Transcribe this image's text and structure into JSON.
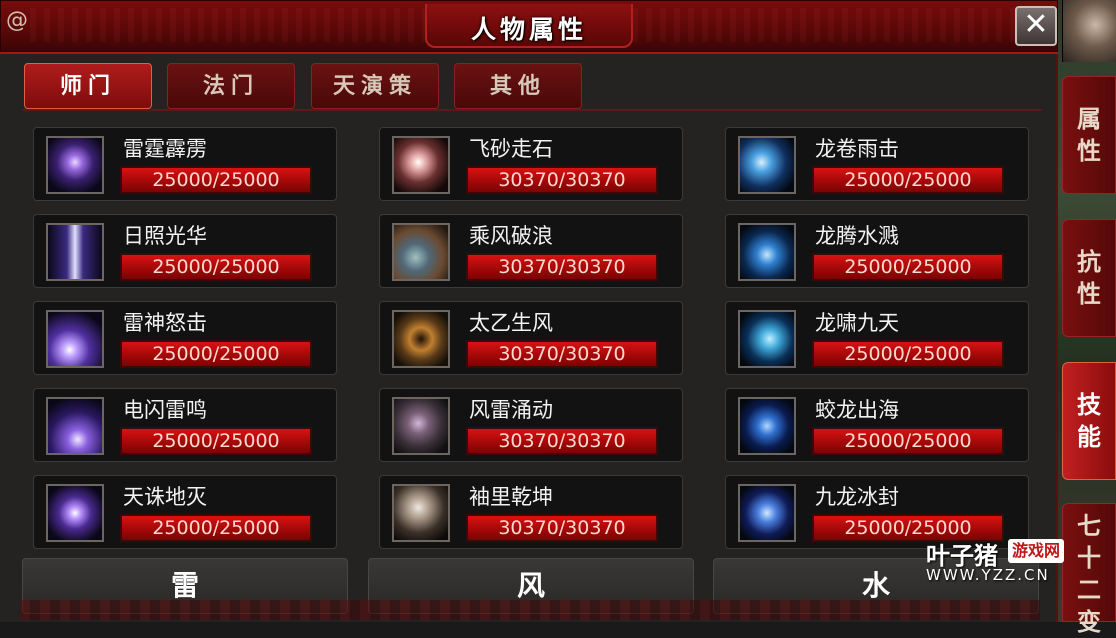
{
  "window": {
    "title": "人物属性",
    "close_label": "✕"
  },
  "tabs": [
    {
      "label": "师门",
      "active": true
    },
    {
      "label": "法门",
      "active": false
    },
    {
      "label": "天演策",
      "active": false
    },
    {
      "label": "其他",
      "active": false
    }
  ],
  "columns": [
    {
      "element": "雷",
      "skills": [
        {
          "name": "雷霆霹雳",
          "value": "25000/25000",
          "icon": "lightning-icon"
        },
        {
          "name": "日照光华",
          "value": "25000/25000",
          "icon": "light-beam-icon"
        },
        {
          "name": "雷神怒击",
          "value": "25000/25000",
          "icon": "thunder-strike-icon"
        },
        {
          "name": "电闪雷鸣",
          "value": "25000/25000",
          "icon": "lightning-flash-icon"
        },
        {
          "name": "天诛地灭",
          "value": "25000/25000",
          "icon": "lightning-burst-icon"
        }
      ]
    },
    {
      "element": "风",
      "skills": [
        {
          "name": "飞砂走石",
          "value": "30370/30370",
          "icon": "sand-storm-icon"
        },
        {
          "name": "乘风破浪",
          "value": "30370/30370",
          "icon": "wave-icon"
        },
        {
          "name": "太乙生风",
          "value": "30370/30370",
          "icon": "whirlwind-icon"
        },
        {
          "name": "风雷涌动",
          "value": "30370/30370",
          "icon": "storm-surge-icon"
        },
        {
          "name": "袖里乾坤",
          "value": "30370/30370",
          "icon": "sleeve-universe-icon"
        }
      ]
    },
    {
      "element": "水",
      "skills": [
        {
          "name": "龙卷雨击",
          "value": "25000/25000",
          "icon": "water-tornado-icon"
        },
        {
          "name": "龙腾水溅",
          "value": "25000/25000",
          "icon": "water-splash-icon"
        },
        {
          "name": "龙啸九天",
          "value": "25000/25000",
          "icon": "dragon-roar-icon"
        },
        {
          "name": "蛟龙出海",
          "value": "25000/25000",
          "icon": "sea-dragon-icon"
        },
        {
          "name": "九龙冰封",
          "value": "25000/25000",
          "icon": "ice-dragon-icon"
        }
      ]
    }
  ],
  "side_tabs": [
    {
      "label": [
        "属",
        "性"
      ],
      "active": false
    },
    {
      "label": [
        "抗",
        "性"
      ],
      "active": false
    },
    {
      "label": [
        "技",
        "能"
      ],
      "active": true
    },
    {
      "label": [
        "七",
        "十",
        "二",
        "变"
      ],
      "active": false
    }
  ],
  "watermark": {
    "main": "叶子猪",
    "badge": "游戏网",
    "url": "WWW.YZZ.CN"
  },
  "colors": {
    "accent_red": "#b01c1c",
    "bar_red": "#d81212",
    "panel_bg": "#252322"
  }
}
